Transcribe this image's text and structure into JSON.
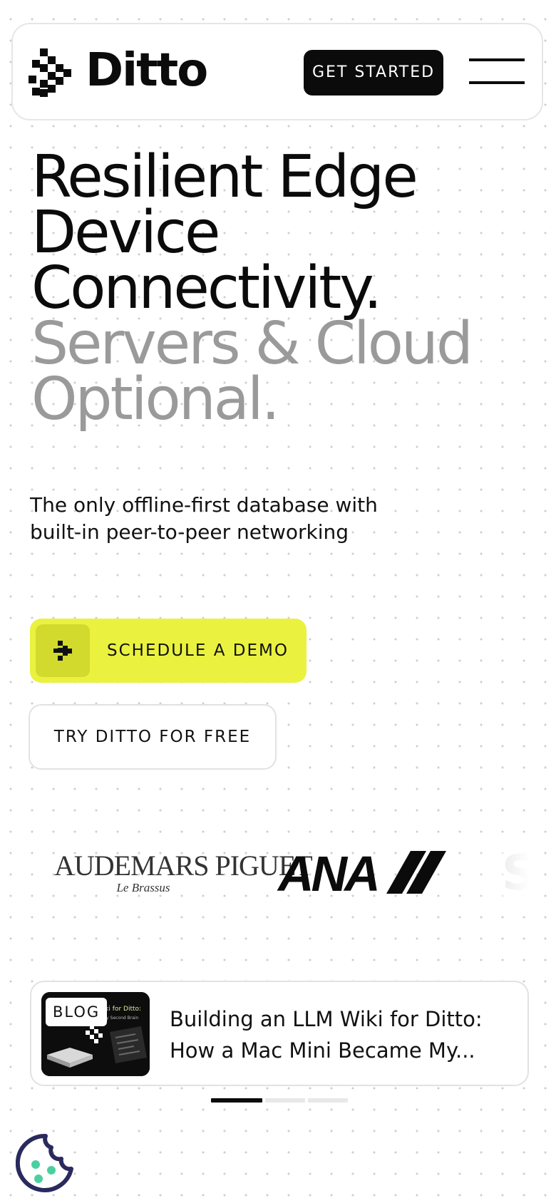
{
  "header": {
    "brand_name": "Ditto",
    "cta_label": "GET STARTED",
    "logo_icon": "ditto-pixel-arrow-icon",
    "menu_icon": "hamburger-menu-icon"
  },
  "hero": {
    "title_lines": [
      "Resilient Edge",
      "Device",
      "Connectivity."
    ],
    "highlight_lines": [
      "Servers & Cloud",
      "Optional."
    ],
    "subtitle_lines": [
      "The only offline-first database with",
      "built-in peer-to-peer networking"
    ]
  },
  "cta": {
    "primary_label": "SCHEDULE A DEMO",
    "primary_icon": "ditto-pixel-arrow-icon",
    "secondary_label": "TRY DITTO FOR FREE"
  },
  "logos": {
    "audemars_main": "AUDEMARS PIGUET",
    "audemars_sub": "Le Brassus",
    "ana": "ANA",
    "partial": "S"
  },
  "blog": {
    "badge": "BLOG",
    "title_lines": [
      "Building an LLM Wiki for Ditto:",
      "How a Mac Mini Became My..."
    ],
    "thumbnail_caption_1": "Wiki for Ditto:",
    "thumbnail_caption_2": "My Second Brain"
  },
  "carousel": {
    "active_index": 1,
    "total": 3
  },
  "cookie": {
    "icon": "cookie-icon"
  },
  "colors": {
    "accent_yellow": "#eaf23f",
    "muted_gray": "#9a9a9a",
    "cookie_teal": "#4ccfa0",
    "cookie_navy": "#2b2a5e"
  }
}
